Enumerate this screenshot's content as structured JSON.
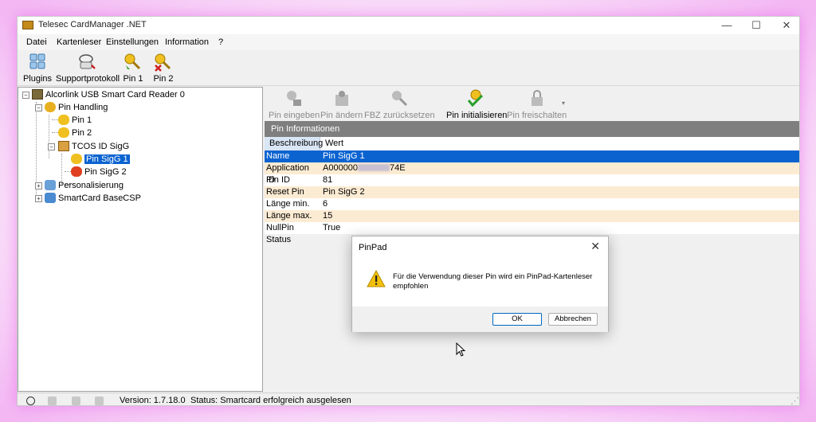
{
  "window": {
    "title": "Telesec CardManager .NET",
    "minimize": "—",
    "maximize": "☐",
    "close": "✕"
  },
  "menu": [
    "Datei",
    "Kartenleser",
    "Einstellungen",
    "Information",
    "?"
  ],
  "toolbar": [
    {
      "label": "Plugins",
      "icon": "plugins-icon"
    },
    {
      "label": "Supportprotokoll",
      "icon": "support-log-icon"
    },
    {
      "label": "Pin 1",
      "icon": "key-icon"
    },
    {
      "label": "Pin 2",
      "icon": "key-red-icon"
    }
  ],
  "tree": {
    "root": "Alcorlink USB Smart Card Reader 0",
    "pin_handling": "Pin Handling",
    "pin1": "Pin 1",
    "pin2": "Pin 2",
    "tcos": "TCOS ID SigG",
    "pin_sigg1": "Pin SigG 1",
    "pin_sigg2": "Pin SigG 2",
    "personalisierung": "Personalisierung",
    "basecsp": "SmartCard BaseCSP"
  },
  "subtoolbar": [
    {
      "label": "Pin eingeben",
      "enabled": false
    },
    {
      "label": "Pin ändern",
      "enabled": false
    },
    {
      "label": "FBZ zurücksetzen",
      "enabled": false
    },
    {
      "label": "Pin initialisieren",
      "enabled": true
    },
    {
      "label": "Pin freischalten",
      "enabled": false
    }
  ],
  "grid": {
    "header": "Pin Informationen",
    "col1": "Beschreibung",
    "col2": "Wert",
    "rows": [
      {
        "key": "Name",
        "value": "Pin SigG 1"
      },
      {
        "key": "Application ID",
        "value_prefix": "A000000",
        "value_suffix": "74E"
      },
      {
        "key": "Pin ID",
        "value": "81"
      },
      {
        "key": "Reset Pin",
        "value": "Pin SigG 2"
      },
      {
        "key": "Länge min.",
        "value": "6"
      },
      {
        "key": "Länge max.",
        "value": "15"
      },
      {
        "key": "NullPin Status",
        "value": "True"
      }
    ]
  },
  "status": {
    "version": "Version: 1.7.18.0",
    "text": "Status: Smartcard erfolgreich ausgelesen"
  },
  "dialog": {
    "title": "PinPad",
    "close": "✕",
    "message": "Für die Verwendung dieser Pin wird ein PinPad-Kartenleser empfohlen",
    "ok": "OK",
    "cancel": "Abbrechen"
  },
  "colors": {
    "selection": "#0b63d0",
    "row_alt": "#fcebd3",
    "grid_header": "#7f7f7f"
  }
}
